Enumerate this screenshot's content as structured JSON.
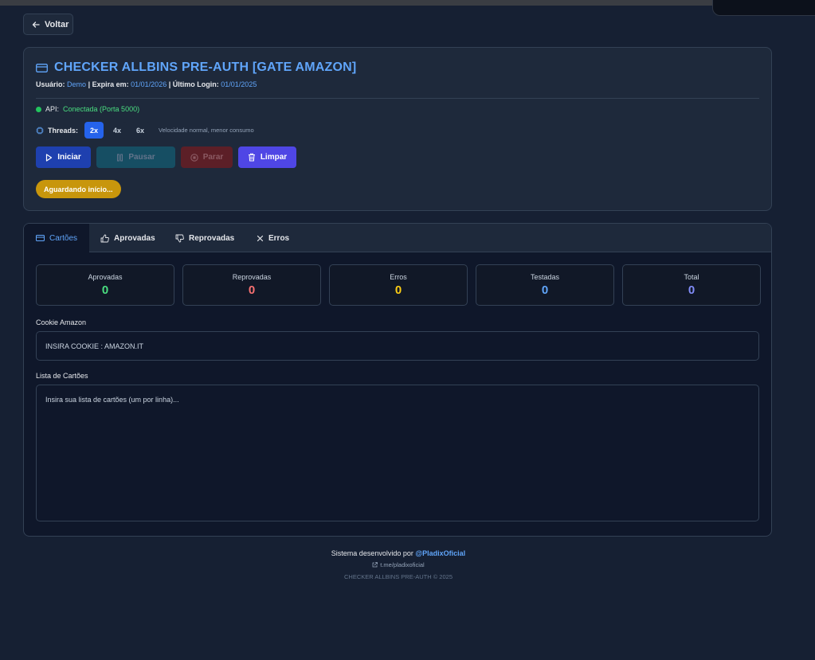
{
  "nav": {
    "back_label": "Voltar"
  },
  "header": {
    "title": "CHECKER ALLBINS PRE-AUTH [GATE AMAZON]",
    "user_label": "Usuário:",
    "user_value": "Demo",
    "expires_label": "Expira em:",
    "expires_value": "01/01/2026",
    "last_login_label": "Último Login:",
    "last_login_value": "01/01/2025",
    "separator": "|",
    "api_label": "API:",
    "api_status": "Conectada (Porta 5000)",
    "api_status_color": "#22c55e",
    "threads_label": "Threads:",
    "thread_options": [
      "2x",
      "4x",
      "6x"
    ],
    "thread_selected": "2x",
    "thread_hint": "Velocidade normal, menor consumo"
  },
  "actions": {
    "start": "Iniciar",
    "pause": "Pausar",
    "stop": "Parar",
    "clear": "Limpar"
  },
  "status": {
    "text": "Aguardando início..."
  },
  "tabs": [
    {
      "label": "Cartões",
      "icon": "card-icon",
      "active": true
    },
    {
      "label": "Aprovadas",
      "icon": "thumbs-up-icon",
      "active": false
    },
    {
      "label": "Reprovadas",
      "icon": "thumbs-down-icon",
      "active": false
    },
    {
      "label": "Erros",
      "icon": "close-icon",
      "active": false
    }
  ],
  "stats": [
    {
      "label": "Aprovadas",
      "value": "0",
      "color": "#4ade80"
    },
    {
      "label": "Reprovadas",
      "value": "0",
      "color": "#f87171"
    },
    {
      "label": "Erros",
      "value": "0",
      "color": "#facc15"
    },
    {
      "label": "Testadas",
      "value": "0",
      "color": "#60a5fa"
    },
    {
      "label": "Total",
      "value": "0",
      "color": "#818cf8"
    }
  ],
  "form": {
    "cookie_label": "Cookie Amazon",
    "cookie_placeholder": "INSIRA COOKIE : AMAZON.IT",
    "cards_label": "Lista de Cartões",
    "cards_placeholder": "Insira sua lista de cartões (um por linha)..."
  },
  "footer": {
    "dev_text": "Sistema desenvolvido por",
    "dev_handle": "@PladixOficial",
    "link_text": "t.me/pladixoficial",
    "copyright": "CHECKER ALLBINS PRE-AUTH © 2025"
  }
}
